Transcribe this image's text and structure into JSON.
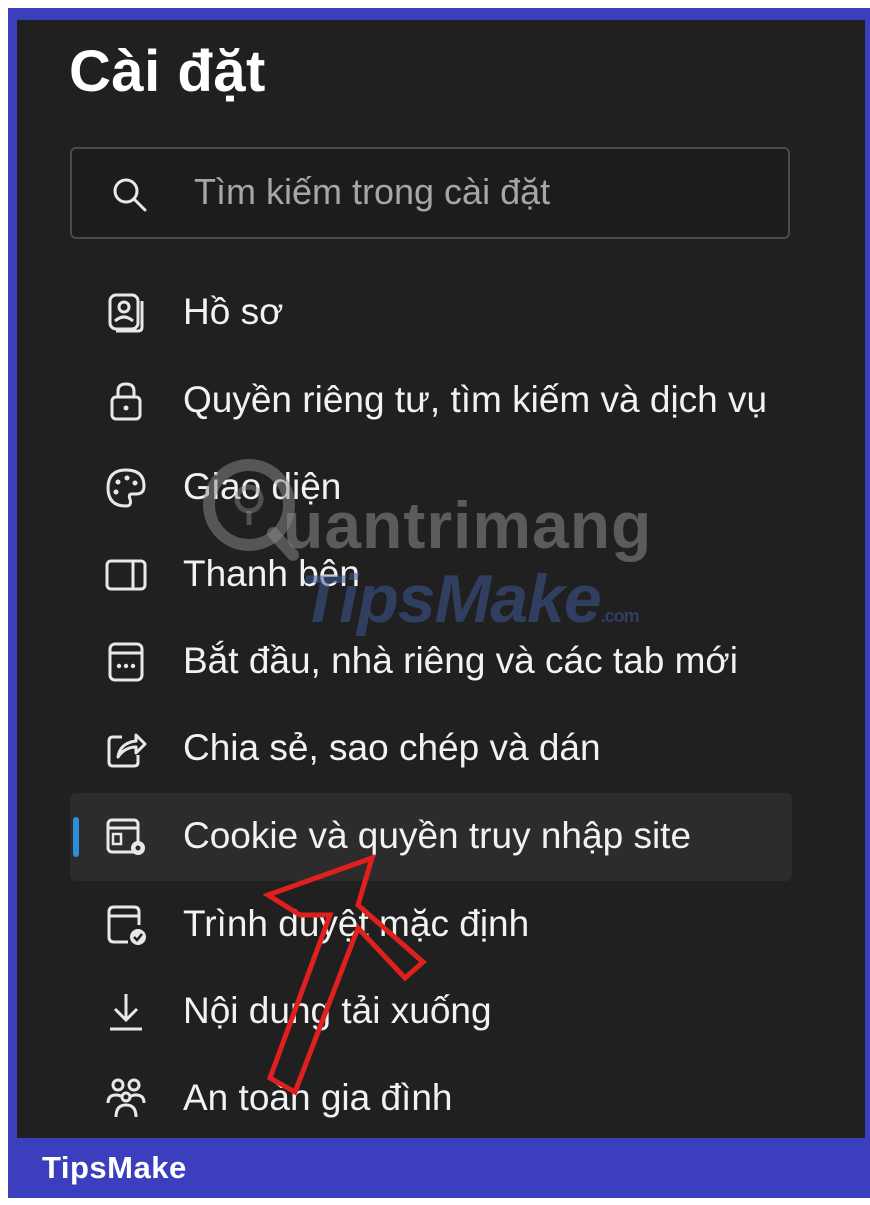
{
  "settings": {
    "title": "Cài đặt",
    "search": {
      "placeholder": "Tìm kiếm trong cài đặt",
      "icon": "search-icon"
    },
    "items": [
      {
        "label": "Hồ sơ",
        "icon": "profile-icon",
        "selected": false
      },
      {
        "label": "Quyền riêng tư, tìm kiếm và dịch vụ",
        "icon": "lock-icon",
        "selected": false
      },
      {
        "label": "Giao diện",
        "icon": "palette-icon",
        "selected": false
      },
      {
        "label": "Thanh bên",
        "icon": "sidebar-icon",
        "selected": false
      },
      {
        "label": "Bắt đầu, nhà riêng và các tab mới",
        "icon": "new-tab-page-icon",
        "selected": false
      },
      {
        "label": "Chia sẻ, sao chép và dán",
        "icon": "share-icon",
        "selected": false
      },
      {
        "label": "Cookie và quyền truy nhập site",
        "icon": "site-permissions-icon",
        "selected": true
      },
      {
        "label": "Trình duyệt mặc định",
        "icon": "default-browser-icon",
        "selected": false
      },
      {
        "label": "Nội dung tải xuống",
        "icon": "download-icon",
        "selected": false
      },
      {
        "label": "An toàn gia đình",
        "icon": "family-icon",
        "selected": false
      }
    ]
  },
  "watermarks": {
    "quantrimang": "uantrimang",
    "tipsmake": "TipsMake",
    "tipsmake_suffix": ".com"
  },
  "footer": {
    "brand": "TipsMake"
  },
  "colors": {
    "frame": "#3b3fbe",
    "panel": "#202020",
    "selected_row": "#2c2c2c",
    "accent_indicator": "#2f8ed8",
    "annotation_arrow": "#e0201e"
  }
}
